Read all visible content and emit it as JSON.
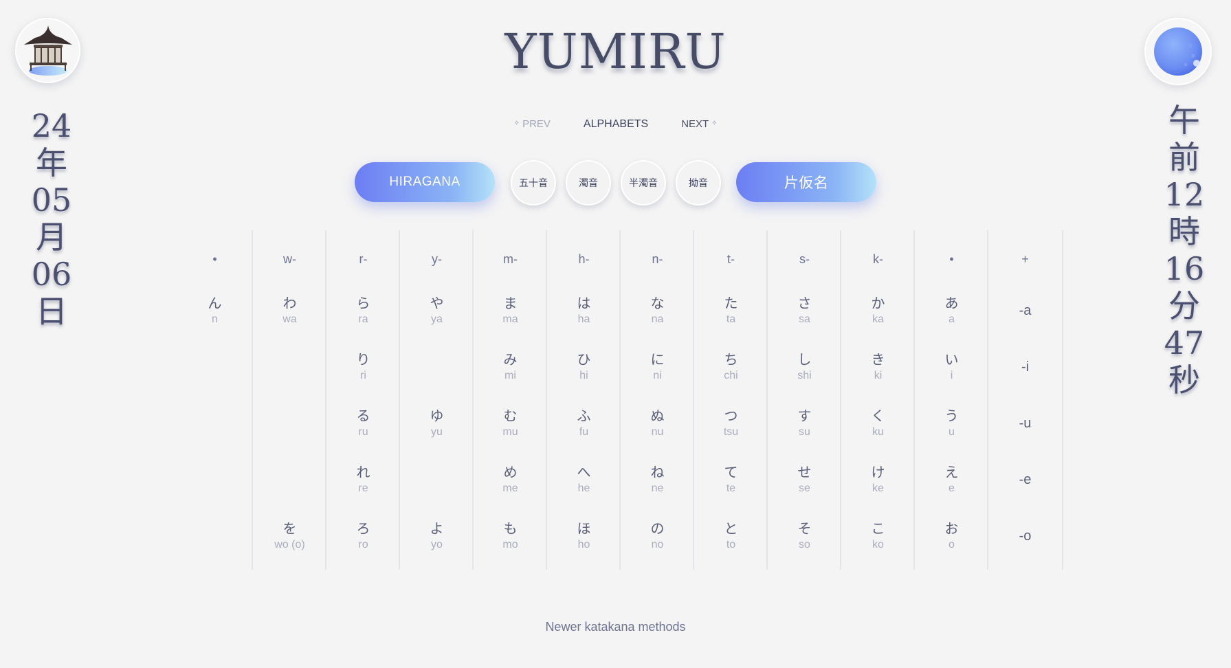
{
  "header": {
    "title": "YUMIRU"
  },
  "date_vertical": [
    "24",
    "年",
    "05",
    "月",
    "06",
    "日"
  ],
  "time_vertical": [
    "午",
    "前",
    "12",
    "時",
    "16",
    "分",
    "47",
    "秒"
  ],
  "nav": {
    "prev": "PREV",
    "current": "ALPHABETS",
    "next": "NEXT"
  },
  "toolbar": {
    "hiragana": "HIRAGANA",
    "gojuon": "五十音",
    "dakuon": "濁音",
    "handakuon": "半濁音",
    "youon": "拗音",
    "katakana": "片仮名"
  },
  "table": {
    "columns": [
      {
        "head": "•",
        "cells": [
          {
            "row": 0,
            "kana": "ん",
            "romaji": "n"
          }
        ]
      },
      {
        "head": "w-",
        "cells": [
          {
            "row": 0,
            "kana": "わ",
            "romaji": "wa"
          },
          {
            "row": 4,
            "kana": "を",
            "romaji": "wo (o)"
          }
        ]
      },
      {
        "head": "r-",
        "cells": [
          {
            "row": 0,
            "kana": "ら",
            "romaji": "ra"
          },
          {
            "row": 1,
            "kana": "り",
            "romaji": "ri"
          },
          {
            "row": 2,
            "kana": "る",
            "romaji": "ru"
          },
          {
            "row": 3,
            "kana": "れ",
            "romaji": "re"
          },
          {
            "row": 4,
            "kana": "ろ",
            "romaji": "ro"
          }
        ]
      },
      {
        "head": "y-",
        "cells": [
          {
            "row": 0,
            "kana": "や",
            "romaji": "ya"
          },
          {
            "row": 2,
            "kana": "ゆ",
            "romaji": "yu"
          },
          {
            "row": 4,
            "kana": "よ",
            "romaji": "yo"
          }
        ]
      },
      {
        "head": "m-",
        "cells": [
          {
            "row": 0,
            "kana": "ま",
            "romaji": "ma"
          },
          {
            "row": 1,
            "kana": "み",
            "romaji": "mi"
          },
          {
            "row": 2,
            "kana": "む",
            "romaji": "mu"
          },
          {
            "row": 3,
            "kana": "め",
            "romaji": "me"
          },
          {
            "row": 4,
            "kana": "も",
            "romaji": "mo"
          }
        ]
      },
      {
        "head": "h-",
        "cells": [
          {
            "row": 0,
            "kana": "は",
            "romaji": "ha"
          },
          {
            "row": 1,
            "kana": "ひ",
            "romaji": "hi"
          },
          {
            "row": 2,
            "kana": "ふ",
            "romaji": "fu"
          },
          {
            "row": 3,
            "kana": "へ",
            "romaji": "he"
          },
          {
            "row": 4,
            "kana": "ほ",
            "romaji": "ho"
          }
        ]
      },
      {
        "head": "n-",
        "cells": [
          {
            "row": 0,
            "kana": "な",
            "romaji": "na"
          },
          {
            "row": 1,
            "kana": "に",
            "romaji": "ni"
          },
          {
            "row": 2,
            "kana": "ぬ",
            "romaji": "nu"
          },
          {
            "row": 3,
            "kana": "ね",
            "romaji": "ne"
          },
          {
            "row": 4,
            "kana": "の",
            "romaji": "no"
          }
        ]
      },
      {
        "head": "t-",
        "cells": [
          {
            "row": 0,
            "kana": "た",
            "romaji": "ta"
          },
          {
            "row": 1,
            "kana": "ち",
            "romaji": "chi"
          },
          {
            "row": 2,
            "kana": "つ",
            "romaji": "tsu"
          },
          {
            "row": 3,
            "kana": "て",
            "romaji": "te"
          },
          {
            "row": 4,
            "kana": "と",
            "romaji": "to"
          }
        ]
      },
      {
        "head": "s-",
        "cells": [
          {
            "row": 0,
            "kana": "さ",
            "romaji": "sa"
          },
          {
            "row": 1,
            "kana": "し",
            "romaji": "shi"
          },
          {
            "row": 2,
            "kana": "す",
            "romaji": "su"
          },
          {
            "row": 3,
            "kana": "せ",
            "romaji": "se"
          },
          {
            "row": 4,
            "kana": "そ",
            "romaji": "so"
          }
        ]
      },
      {
        "head": "k-",
        "cells": [
          {
            "row": 0,
            "kana": "か",
            "romaji": "ka"
          },
          {
            "row": 1,
            "kana": "き",
            "romaji": "ki"
          },
          {
            "row": 2,
            "kana": "く",
            "romaji": "ku"
          },
          {
            "row": 3,
            "kana": "け",
            "romaji": "ke"
          },
          {
            "row": 4,
            "kana": "こ",
            "romaji": "ko"
          }
        ]
      },
      {
        "head": "•",
        "cells": [
          {
            "row": 0,
            "kana": "あ",
            "romaji": "a"
          },
          {
            "row": 1,
            "kana": "い",
            "romaji": "i"
          },
          {
            "row": 2,
            "kana": "う",
            "romaji": "u"
          },
          {
            "row": 3,
            "kana": "え",
            "romaji": "e"
          },
          {
            "row": 4,
            "kana": "お",
            "romaji": "o"
          }
        ]
      }
    ],
    "vowel_column": {
      "head": "+",
      "rows": [
        "-a",
        "-i",
        "-u",
        "-e",
        "-o"
      ]
    }
  },
  "footer": {
    "link": "Newer katakana methods"
  },
  "colors": {
    "accent_start": "#6c7ef3",
    "accent_end": "#b4e2f8",
    "background": "#f4f4f4"
  }
}
